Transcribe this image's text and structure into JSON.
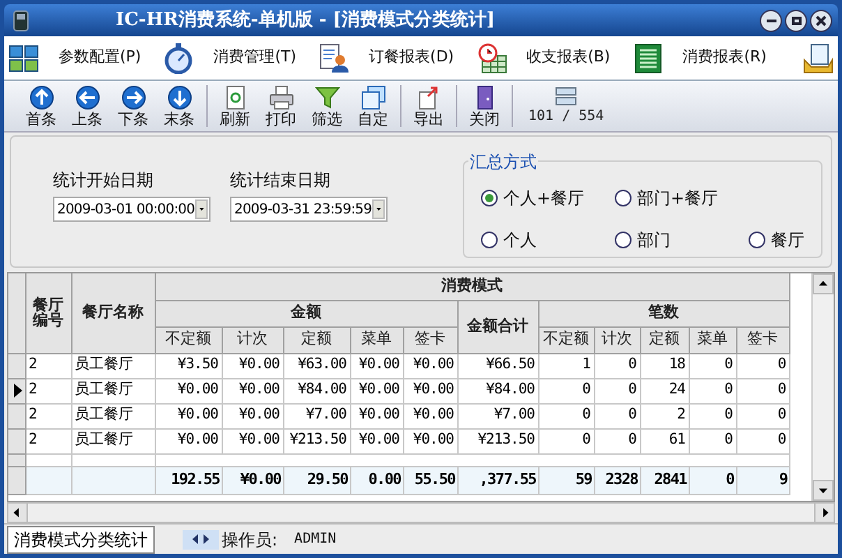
{
  "window": {
    "title": "IC-HR消费系统-单机版 - [消费模式分类统计]"
  },
  "menu": [
    {
      "label": "参数配置(P)",
      "kind": "grid"
    },
    {
      "label": "消费管理(T)",
      "kind": "stopwatch"
    },
    {
      "label": "订餐报表(D)",
      "kind": "person"
    },
    {
      "label": "收支报表(B)",
      "kind": "chart"
    },
    {
      "label": "消费报表(R)",
      "kind": "sheet"
    }
  ],
  "toolbar": [
    {
      "label": "首条",
      "kind": "up"
    },
    {
      "label": "上条",
      "kind": "left"
    },
    {
      "label": "下条",
      "kind": "right"
    },
    {
      "label": "末条",
      "kind": "down"
    },
    {
      "label": "刷新",
      "kind": "refresh"
    },
    {
      "label": "打印",
      "kind": "print"
    },
    {
      "label": "筛选",
      "kind": "filter"
    },
    {
      "label": "自定",
      "kind": "custom"
    },
    {
      "label": "导出",
      "kind": "export"
    },
    {
      "label": "关闭",
      "kind": "close"
    }
  ],
  "record_counter": "101 / 554",
  "filters": [
    {
      "label": "统计开始日期",
      "value": "2009-03-01 00:00:00"
    },
    {
      "label": "统计结束日期",
      "value": "2009-03-31 23:59:59"
    }
  ],
  "summary_mode": {
    "title": "汇总方式",
    "options": [
      {
        "label": "个人+餐厅",
        "selected": true
      },
      {
        "label": "部门+餐厅",
        "selected": false
      },
      {
        "label": "个人",
        "selected": false
      },
      {
        "label": "部门",
        "selected": false
      },
      {
        "label": "餐厅",
        "selected": false
      }
    ]
  },
  "table": {
    "row_headers": [
      "餐厅编号",
      "餐厅名称"
    ],
    "super_header": "消费模式",
    "amount_group": {
      "label": "金额",
      "columns": [
        "不定额",
        "计次",
        "定额",
        "菜单",
        "签卡"
      ]
    },
    "amount_total": "金额合计",
    "count_group": {
      "label": "笔数",
      "columns": [
        "不定额",
        "计次",
        "定额",
        "菜单",
        "签卡"
      ]
    },
    "rows": [
      {
        "current": false,
        "cells": [
          "2",
          "员工餐厅",
          "¥3.50",
          "¥0.00",
          "¥63.00",
          "¥0.00",
          "¥0.00",
          "¥66.50",
          "1",
          "0",
          "18",
          "0",
          "0"
        ]
      },
      {
        "current": true,
        "cells": [
          "2",
          "员工餐厅",
          "¥0.00",
          "¥0.00",
          "¥84.00",
          "¥0.00",
          "¥0.00",
          "¥84.00",
          "0",
          "0",
          "24",
          "0",
          "0"
        ]
      },
      {
        "current": false,
        "cells": [
          "2",
          "员工餐厅",
          "¥0.00",
          "¥0.00",
          "¥7.00",
          "¥0.00",
          "¥0.00",
          "¥7.00",
          "0",
          "0",
          "2",
          "0",
          "0"
        ]
      },
      {
        "current": false,
        "cells": [
          "2",
          "员工餐厅",
          "¥0.00",
          "¥0.00",
          "¥213.50",
          "¥0.00",
          "¥0.00",
          "¥213.50",
          "0",
          "0",
          "61",
          "0",
          "0"
        ]
      }
    ],
    "totals": [
      "192.55",
      "¥0.00",
      "29.50",
      "0.00",
      "55.50",
      ",377.55",
      "59",
      "2328",
      "2841",
      "0",
      "9"
    ]
  },
  "status_bar": {
    "tabs": [
      {
        "label": "消费模式分类统计",
        "selected": true
      }
    ],
    "operator_label": "操作员:",
    "operator": "ADMIN"
  }
}
